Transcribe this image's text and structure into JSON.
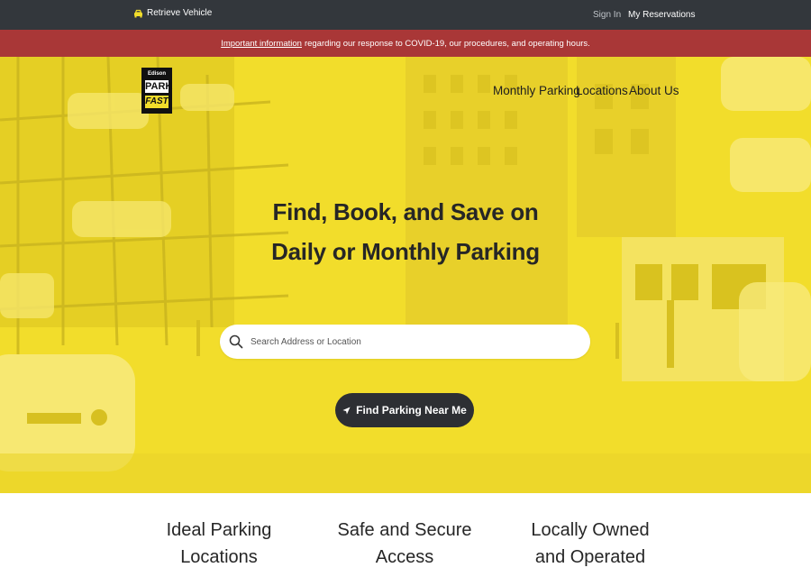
{
  "topbar": {
    "retrieve_label": "Retrieve Vehicle",
    "retrieve_icon": "car-icon",
    "signin_label": "Sign In",
    "reservations_label": "My Reservations"
  },
  "alert": {
    "link_text": "Important information",
    "text": "regarding our response to COVID-19, our procedures, and operating hours."
  },
  "logo": {
    "top": "Edison",
    "middle": "PARK",
    "bottom": "FAST"
  },
  "nav": {
    "items": [
      "Monthly Parking",
      "Locations",
      "About Us"
    ]
  },
  "hero": {
    "headline_line1": "Find, Book, and Save on",
    "headline_line2": "Daily or Monthly Parking",
    "search_placeholder": "Search Address or Location",
    "search_icon": "search-icon",
    "near_button_label": "Find Parking Near Me",
    "near_button_icon": "location-arrow-icon"
  },
  "features": {
    "items": [
      {
        "line1": "Ideal Parking",
        "line2": "Locations"
      },
      {
        "line1": "Safe and Secure",
        "line2": "Access"
      },
      {
        "line1": "Locally Owned",
        "line2": "and Operated"
      }
    ]
  },
  "colors": {
    "topbar": "#33373c",
    "alert": "#a93737",
    "hero_yellow": "#f2dd2b",
    "button_dark": "#2d2f33"
  }
}
